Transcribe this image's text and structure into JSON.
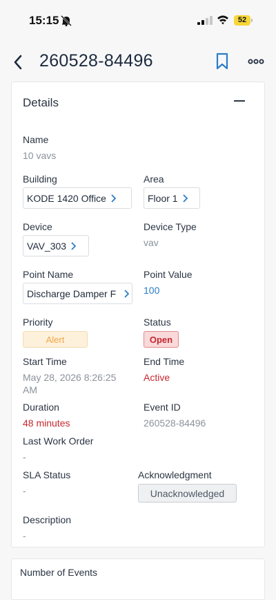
{
  "status_bar": {
    "time": "15:15",
    "battery": "52",
    "icons": [
      "bell-slash-icon",
      "cell-signal-icon",
      "wifi-icon",
      "battery-icon"
    ]
  },
  "header": {
    "title": "260528-84496",
    "icons": [
      "chevron-left-icon",
      "bookmark-icon",
      "more-dots-icon"
    ]
  },
  "details": {
    "title": "Details",
    "name": {
      "label": "Name",
      "value": "10 vavs"
    },
    "building": {
      "label": "Building",
      "value": "KODE 1420 Office"
    },
    "area": {
      "label": "Area",
      "value": "Floor 1"
    },
    "device": {
      "label": "Device",
      "value": "VAV_303"
    },
    "device_type": {
      "label": "Device Type",
      "value": "vav"
    },
    "point_name": {
      "label": "Point Name",
      "value": "Discharge Damper F"
    },
    "point_value": {
      "label": "Point Value",
      "value": "100"
    },
    "priority": {
      "label": "Priority",
      "value": "Alert"
    },
    "status": {
      "label": "Status",
      "value": "Open"
    },
    "start_time": {
      "label": "Start Time",
      "value_line1": "May 28, 2026 8:26:25",
      "value_line2": "AM"
    },
    "end_time": {
      "label": "End Time",
      "value": "Active"
    },
    "duration": {
      "label": "Duration",
      "value": "48 minutes"
    },
    "event_id": {
      "label": "Event ID",
      "value": "260528-84496"
    },
    "last_work_order": {
      "label": "Last Work Order",
      "value": "-"
    },
    "sla_status": {
      "label": "SLA Status",
      "value": "-"
    },
    "acknowledgment": {
      "label": "Acknowledgment",
      "value": "Unacknowledged"
    },
    "description": {
      "label": "Description",
      "value": "-"
    }
  },
  "events_card": {
    "title": "Number of Events"
  },
  "colors": {
    "accent": "#2a7cc7",
    "danger": "#c5282f",
    "warning": "#f2a648",
    "battery": "#f6d63a"
  }
}
